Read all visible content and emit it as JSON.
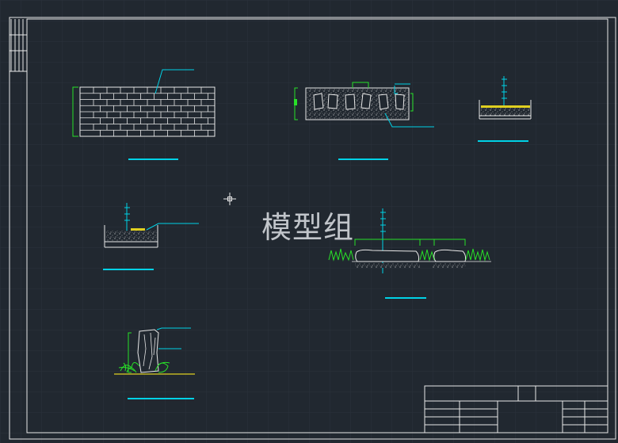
{
  "drawing": {
    "background": "#212830",
    "grid_color": "#2b333c",
    "line_white": "#e8e8e8",
    "line_cyan": "#00d2e6",
    "line_green": "#28e028",
    "line_yellow": "#e0d020",
    "watermark_text": "模型组"
  },
  "details": [
    {
      "id": "brick-wall-elevation"
    },
    {
      "id": "stone-panel-section"
    },
    {
      "id": "small-paving-section"
    },
    {
      "id": "edge-paving-section"
    },
    {
      "id": "stepping-stone-section"
    },
    {
      "id": "rock-planting-elevation"
    }
  ],
  "cursor": {
    "icon": "crosshair-icon"
  },
  "title_block": {
    "rows": 4
  }
}
